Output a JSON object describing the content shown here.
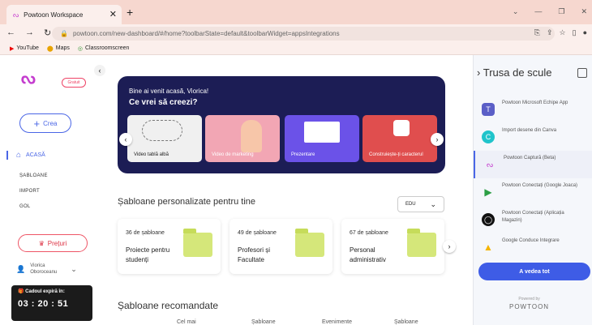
{
  "browser": {
    "tab_title": "Powtoon Workspace",
    "url": "powtoon.com/new-dashboard/#/home?toolbarState=default&toolbarWidget=appsIntegrations",
    "bookmarks": [
      "YouTube",
      "Maps",
      "Classroomscreen"
    ]
  },
  "sidebar": {
    "badge": "Gratuit",
    "create": "Crea",
    "home": "ACASĂ",
    "nav": [
      "ȘABLOANE",
      "IMPORT",
      "GOL"
    ],
    "premium": "Prețuri",
    "user": "Viorica Oboroceanu",
    "trial_title": "Cadoul expiră în:",
    "countdown": "03 : 20 : 51"
  },
  "banner": {
    "greeting": "Bine ai venit acasă, Viorica!",
    "question": "Ce vrei să creezi?",
    "cards": [
      "Video tablă albă",
      "Video de marketing",
      "Prezentare",
      "Construiește-ți caracterul"
    ]
  },
  "templates": {
    "title": "Șabloane personalizate pentru tine",
    "filter": "EDU",
    "cards": [
      {
        "count": "36 de șabloane",
        "desc": "Proiecte pentru studenți"
      },
      {
        "count": "49 de șabloane",
        "desc": "Profesori și Facultate"
      },
      {
        "count": "67 de șabloane",
        "desc": "Personal administrativ"
      }
    ]
  },
  "recommended": {
    "title": "Șabloane recomandate",
    "subtabs": [
      "Cel mai",
      "Șabloane",
      "Evenimente",
      "Șabloane"
    ]
  },
  "toolkit": {
    "title": "Trusa de scule",
    "items": [
      {
        "label": "Powtoon Microsoft Echipe App",
        "color": "#5b5fc7"
      },
      {
        "label": "Import desene din Canva",
        "color": "#20c4cb"
      },
      {
        "label": "Powtoon Captură (Beta)",
        "color": "#c43cce"
      },
      {
        "label": "Powtoon Conectați (Google Joaca)",
        "color": "#2c9f45"
      },
      {
        "label": "Powtoon Conectați (Aplicația Magazin)",
        "color": "#111111"
      },
      {
        "label": "Google Conduce Integrare",
        "color": "#f4b400"
      }
    ],
    "see_all": "A vedea tot",
    "powered_by": "Powered by",
    "brand": "POWTOON"
  }
}
